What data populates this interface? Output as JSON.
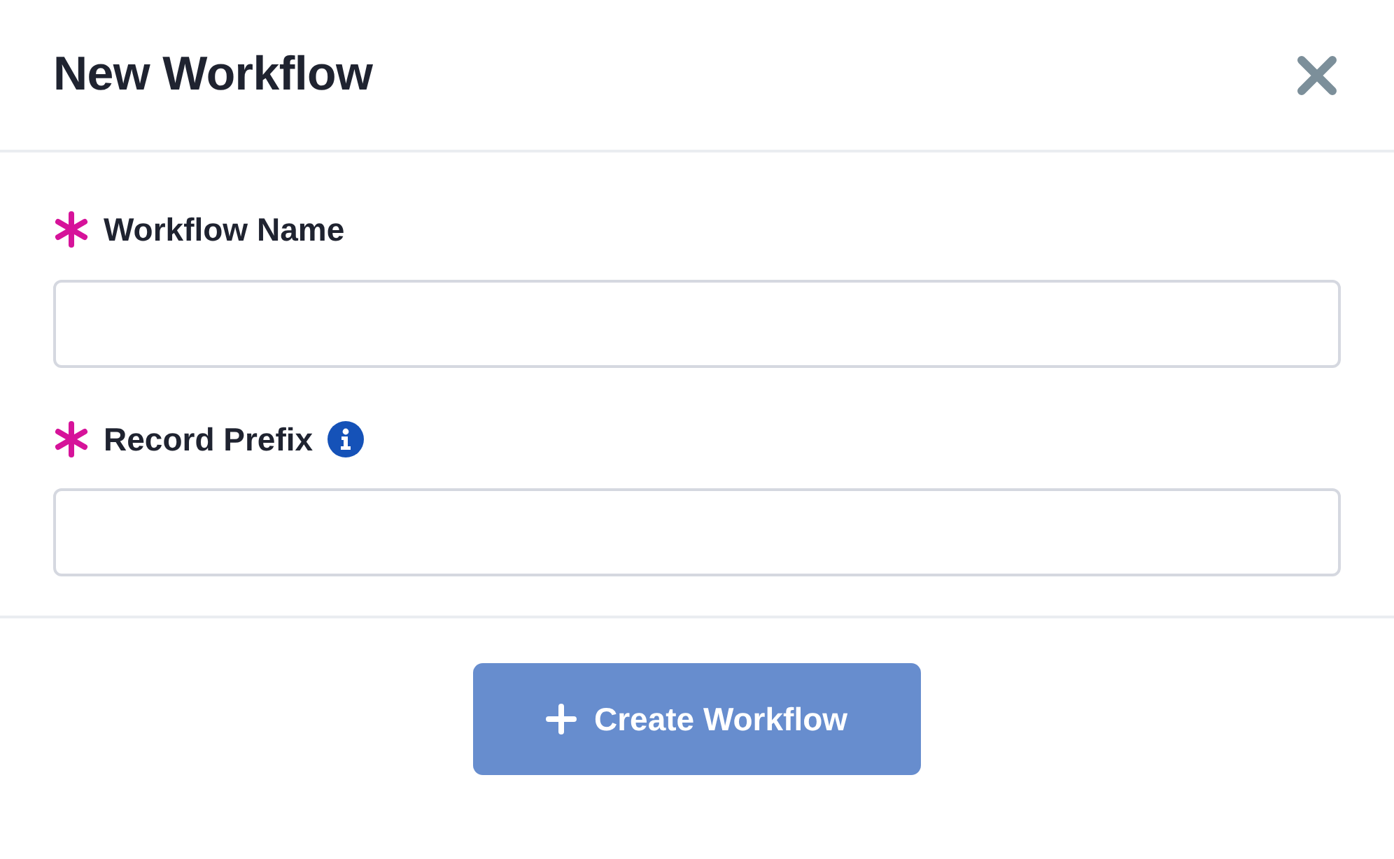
{
  "dialog": {
    "title": "New Workflow"
  },
  "fields": [
    {
      "label": "Workflow Name",
      "required": true,
      "info": false
    },
    {
      "label": "Record Prefix",
      "required": true,
      "info": true
    }
  ],
  "footer": {
    "button": {
      "label": "Create Workflow",
      "disabled": true
    }
  }
}
